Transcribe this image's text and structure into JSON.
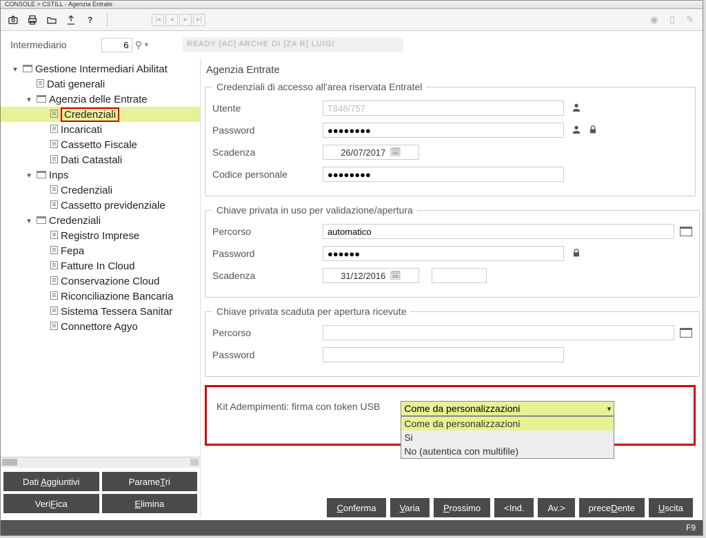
{
  "window": {
    "title": "CONSOLE > CSTILL - Agenzia Entrate"
  },
  "intermediario": {
    "label": "Intermediario",
    "num": "6",
    "name": "READY [AC]  ARCHE DI   [ZA R]  LUIGI"
  },
  "tree": {
    "root": "Gestione Intermediari Abilitat",
    "dati_generali": "Dati generali",
    "agenzia": "Agenzia delle Entrate",
    "credenziali": "Credenziali",
    "incaricati": "Incaricati",
    "cassetto_fiscale": "Cassetto Fiscale",
    "dati_catastali": "Dati Catastali",
    "inps": "Inps",
    "inps_cred": "Credenziali",
    "inps_cass": "Cassetto previdenziale",
    "cred_group": "Credenziali",
    "reg_imprese": "Registro Imprese",
    "fepa": "Fepa",
    "fat_cloud": "Fatture In Cloud",
    "cons_cloud": "Conservazione Cloud",
    "ric_banc": "Riconciliazione Bancaria",
    "tessera": "Sistema Tessera Sanitar",
    "agyo": "Connettore Agyo"
  },
  "left_buttons": {
    "dati_aggiuntivi": "Dati Aggiuntivi",
    "parametri": "ParameTri",
    "verifica": "VeriFica",
    "elimina": "Elimina"
  },
  "panel": {
    "title": "Agenzia Entrate",
    "group1": "Credenziali di accesso all'area riservata Entratel",
    "utente_label": "Utente",
    "utente_val": "T848/757",
    "password_label": "Password",
    "password_val": "●●●●●●●●",
    "scadenza_label": "Scadenza",
    "scadenza_val": "26/07/2017",
    "codice_label": "Codice personale",
    "codice_val": "●●●●●●●●",
    "group2": "Chiave privata in uso per validazione/apertura",
    "percorso_label": "Percorso",
    "percorso_val": "automatico",
    "password2_label": "Password",
    "password2_val": "●●●●●●",
    "scadenza2_label": "Scadenza",
    "scadenza2_val": "31/12/2016",
    "group3": "Chiave privata scaduta per apertura ricevute",
    "percorso3_label": "Percorso",
    "password3_label": "Password",
    "kit_label": "Kit Adempimenti: firma con token USB",
    "kit_selected": "Come da personalizzazioni",
    "kit_opts": [
      "Come da personalizzazioni",
      "Si",
      "No (autentica con multifile)"
    ]
  },
  "bottom": {
    "conferma": "Conferma",
    "varia": "Varia",
    "prossimo": "Prossimo",
    "ind": "<Ind.",
    "av": "Av.>",
    "precedente": "preceDente",
    "uscita": "Uscita"
  },
  "status": {
    "key": "F9"
  }
}
